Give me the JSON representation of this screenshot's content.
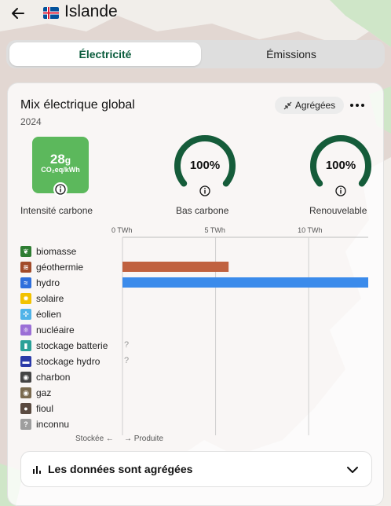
{
  "header": {
    "country": "Islande",
    "back_icon": "arrow-left-icon",
    "flag_icon": "iceland-flag-icon"
  },
  "tabs": [
    {
      "label": "Électricité",
      "active": true
    },
    {
      "label": "Émissions",
      "active": false
    }
  ],
  "card": {
    "title": "Mix électrique global",
    "year": "2024",
    "aggregate_button": "Agrégées",
    "carbon_intensity": {
      "value": "28",
      "unit_g": "g",
      "unit": "CO₂eq/kWh",
      "label": "Intensité carbone",
      "color": "#5cb85c"
    },
    "low_carbon": {
      "value": "100%",
      "fraction": 1.0,
      "label": "Bas carbone"
    },
    "renewable": {
      "value": "100%",
      "fraction": 1.0,
      "label": "Renouvelable"
    },
    "gauge_color": "#155c3a"
  },
  "chart_data": {
    "type": "bar",
    "orientation": "horizontal",
    "x_axis_ticks": [
      "0 TWh",
      "5 TWh",
      "10 TWh"
    ],
    "xlim": [
      0,
      13.2
    ],
    "categories": [
      "biomasse",
      "géothermie",
      "hydro",
      "solaire",
      "éolien",
      "nucléaire",
      "stockage batterie",
      "stockage hydro",
      "charbon",
      "gaz",
      "fioul",
      "inconnu"
    ],
    "values": [
      0,
      5.7,
      13.2,
      0,
      0,
      0,
      null,
      null,
      0,
      0,
      0,
      0
    ],
    "unknown_markers": [
      "?",
      "?"
    ],
    "bar_colors": {
      "géothermie": "#c0613f",
      "hydro": "#3b8beb"
    },
    "footer_stored": "Stockée ←",
    "footer_produced": "→ Produite"
  },
  "legend_icons": [
    {
      "name": "biomass-icon",
      "color": "#2e7d32",
      "glyph": "❦"
    },
    {
      "name": "geothermal-icon",
      "color": "#a24b2a",
      "glyph": "≋"
    },
    {
      "name": "hydro-icon",
      "color": "#2f6fdc",
      "glyph": "≈"
    },
    {
      "name": "solar-icon",
      "color": "#f2c200",
      "glyph": "✹"
    },
    {
      "name": "wind-icon",
      "color": "#4fb3e8",
      "glyph": "✣"
    },
    {
      "name": "nuclear-icon",
      "color": "#9b6fd6",
      "glyph": "⚛"
    },
    {
      "name": "battery-storage-icon",
      "color": "#2aa198",
      "glyph": "▮"
    },
    {
      "name": "hydro-storage-icon",
      "color": "#2b3aa8",
      "glyph": "▬"
    },
    {
      "name": "coal-icon",
      "color": "#444444",
      "glyph": "◉"
    },
    {
      "name": "gas-icon",
      "color": "#7a6a4f",
      "glyph": "◉"
    },
    {
      "name": "oil-icon",
      "color": "#5a4a40",
      "glyph": "●"
    },
    {
      "name": "unknown-icon",
      "color": "#9e9e9e",
      "glyph": "?"
    }
  ],
  "aggregated_bar": {
    "label": "Les données sont agrégées"
  }
}
